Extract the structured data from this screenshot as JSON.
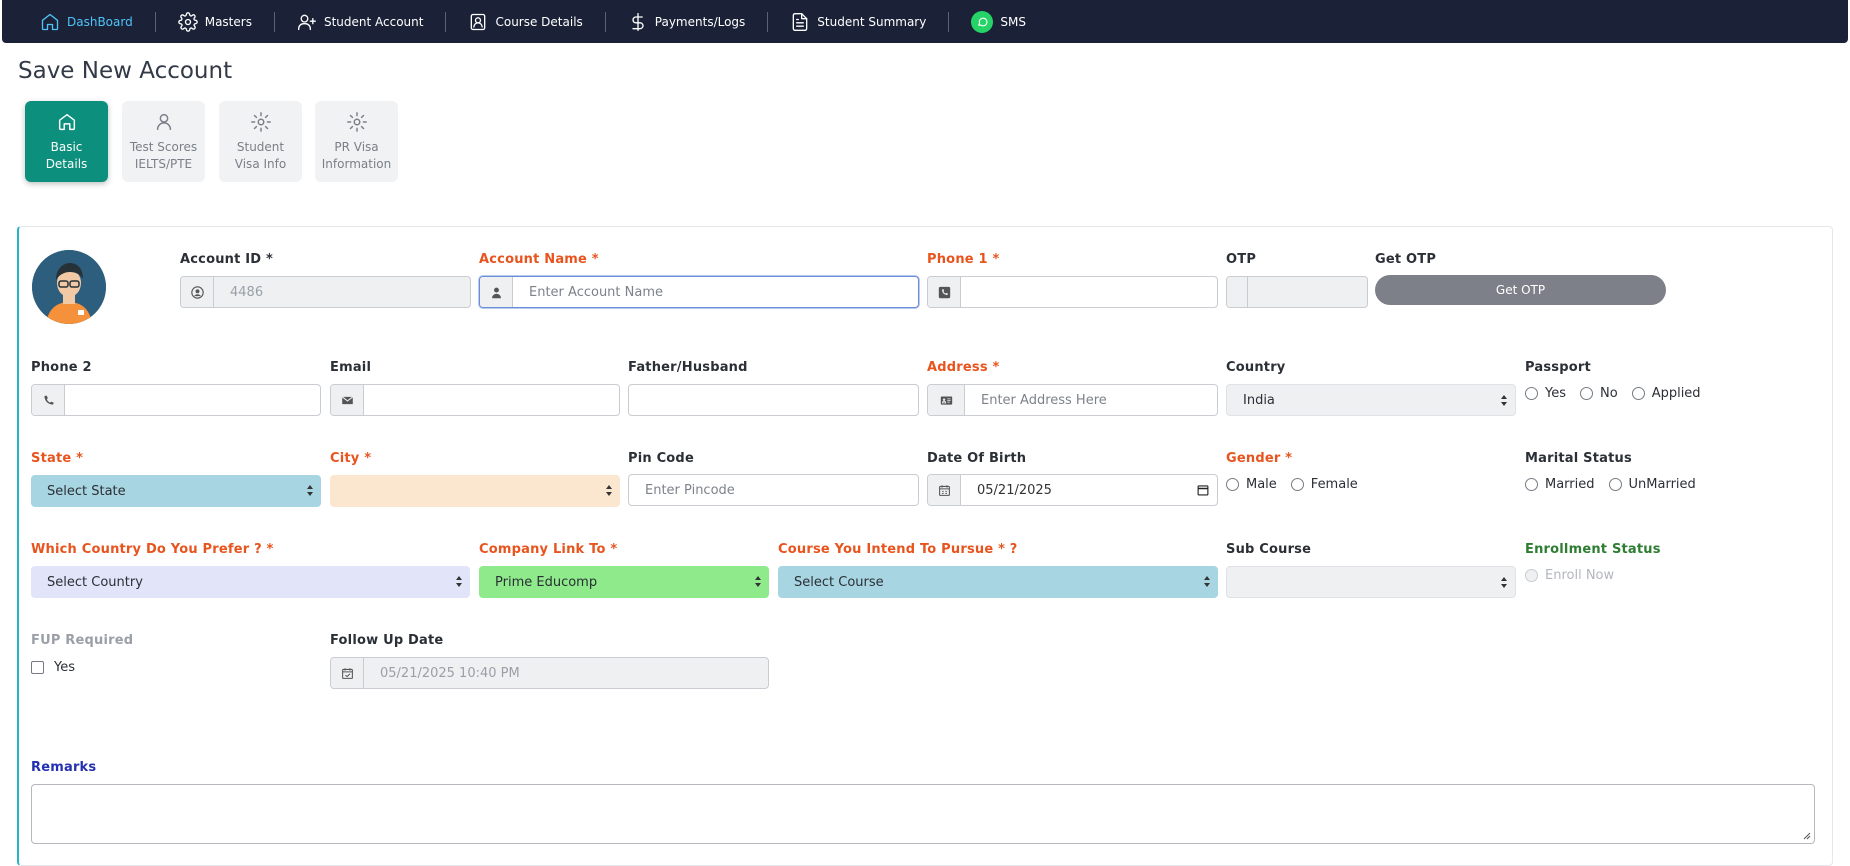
{
  "nav": {
    "items": [
      {
        "label": "DashBoard",
        "icon": "home-icon"
      },
      {
        "label": "Masters",
        "icon": "gear-icon"
      },
      {
        "label": "Student Account",
        "icon": "user-plus-icon"
      },
      {
        "label": "Course Details",
        "icon": "contact-book-icon"
      },
      {
        "label": "Payments/Logs",
        "icon": "dollar-icon"
      },
      {
        "label": "Student Summary",
        "icon": "file-icon"
      },
      {
        "label": "SMS",
        "icon": "whatsapp-icon"
      }
    ],
    "active_color": "#4fc3f7",
    "bg_color": "#1b2238"
  },
  "page_title": "Save New Account",
  "steps": [
    {
      "line1": "Basic",
      "line2": "Details",
      "icon": "home-icon",
      "active": true
    },
    {
      "line1": "Test Scores",
      "line2": "IELTS/PTE",
      "icon": "user-icon",
      "active": false
    },
    {
      "line1": "Student",
      "line2": "Visa Info",
      "icon": "gear-icon",
      "active": false
    },
    {
      "line1": "PR Visa",
      "line2": "Information",
      "icon": "gear-icon",
      "active": false
    }
  ],
  "form": {
    "account_id": {
      "label": "Account ID *",
      "value": "4486"
    },
    "account_name": {
      "label": "Account Name *",
      "placeholder": "Enter Account Name"
    },
    "phone1": {
      "label": "Phone 1 *",
      "value": ""
    },
    "otp": {
      "label": "OTP",
      "value": ""
    },
    "get_otp": {
      "label": "Get OTP",
      "button": "Get OTP"
    },
    "phone2": {
      "label": "Phone 2",
      "value": ""
    },
    "email": {
      "label": "Email",
      "value": ""
    },
    "father": {
      "label": "Father/Husband",
      "value": ""
    },
    "address": {
      "label": "Address *",
      "placeholder": "Enter Address Here"
    },
    "country": {
      "label": "Country",
      "value": "India"
    },
    "passport": {
      "label": "Passport",
      "options": [
        "Yes",
        "No",
        "Applied"
      ]
    },
    "state": {
      "label": "State *",
      "value": "Select State",
      "color": "#a8d5e2"
    },
    "city": {
      "label": "City *",
      "value": "",
      "color": "#fbe7cf"
    },
    "pincode": {
      "label": "Pin Code",
      "placeholder": "Enter Pincode"
    },
    "dob": {
      "label": "Date Of Birth",
      "value": "05/21/2025"
    },
    "gender": {
      "label": "Gender *",
      "options": [
        "Male",
        "Female"
      ]
    },
    "marital": {
      "label": "Marital Status",
      "options": [
        "Married",
        "UnMarried"
      ]
    },
    "pref_country": {
      "label": "Which Country Do You Prefer ? *",
      "value": "Select Country",
      "color": "#e2e4f9"
    },
    "company": {
      "label": "Company Link To *",
      "value": "Prime Educomp",
      "color": "#8eea8a"
    },
    "course": {
      "label": "Course You Intend To Pursue * ?",
      "value": "Select Course",
      "color": "#a8d5e2"
    },
    "sub_course": {
      "label": "Sub Course",
      "value": ""
    },
    "enrollment": {
      "label": "Enrollment Status",
      "option": "Enroll Now"
    },
    "fup": {
      "label": "FUP Required",
      "option": "Yes"
    },
    "follow_up": {
      "label": "Follow Up Date",
      "value": "05/21/2025 10:40 PM"
    },
    "remarks": {
      "label": "Remarks",
      "value": ""
    }
  }
}
